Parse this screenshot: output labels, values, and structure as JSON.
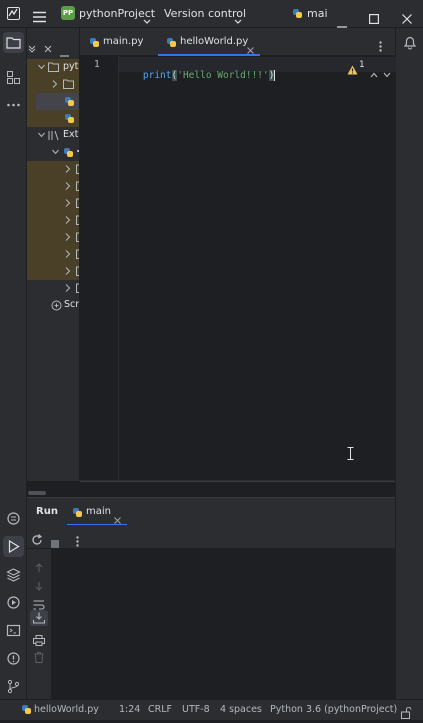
{
  "titlebar": {
    "project_badge": "PP",
    "project_name": "pythonProject",
    "vcs_label": "Version control",
    "run_config": "mai"
  },
  "project_panel": {
    "root_label": "pyth",
    "ext_label": "Exte",
    "scratches_label": "Scra"
  },
  "tabs": [
    {
      "label": "main.py",
      "active": false
    },
    {
      "label": "helloWorld.py",
      "active": true
    }
  ],
  "editor": {
    "line_number": "1",
    "code_fn": "print",
    "code_open": "(",
    "code_string": "'Hello World!!!'",
    "code_close": ")",
    "warning_count": "1"
  },
  "run_panel": {
    "title": "Run",
    "tab_label": "main"
  },
  "statusbar": {
    "file": "helloWorld.py",
    "position": "1:24",
    "line_ending": "CRLF",
    "encoding": "UTF-8",
    "indent": "4 spaces",
    "interpreter": "Python 3.6 (pythonProject)"
  },
  "colors": {
    "accent": "#3574f0",
    "string": "#6aab73",
    "warning": "#f2c55c"
  }
}
